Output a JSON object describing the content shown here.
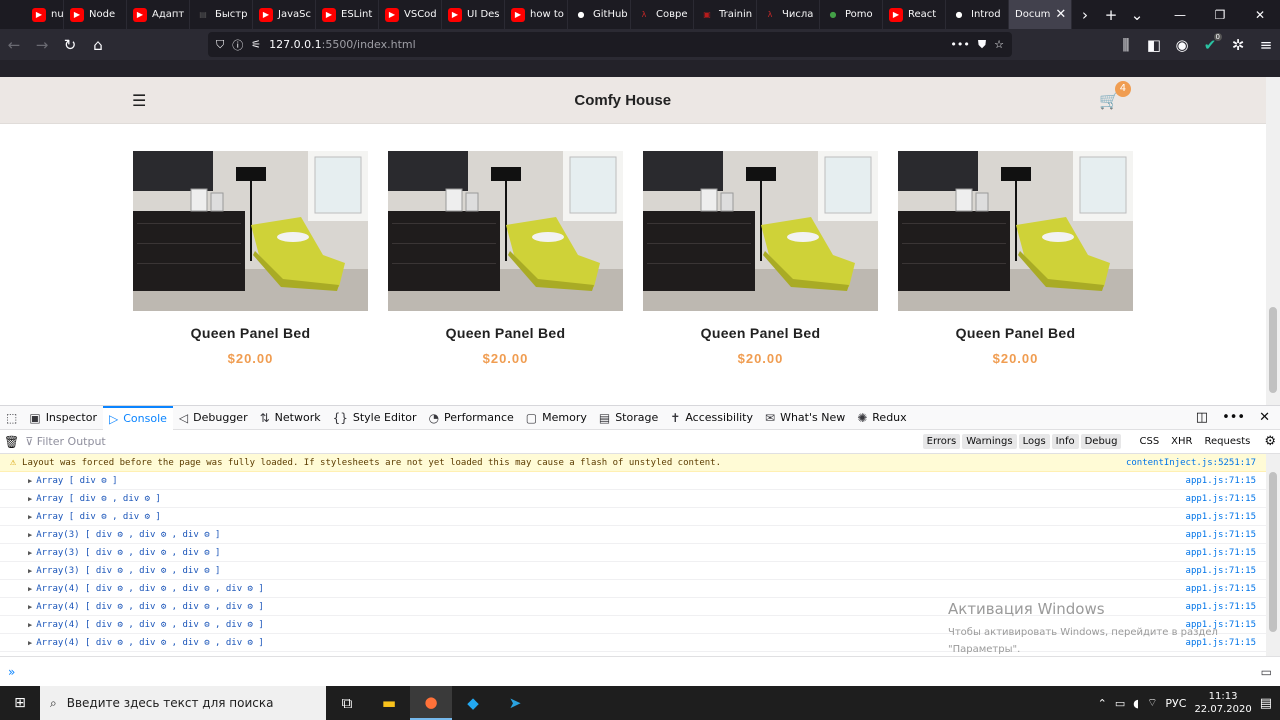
{
  "browser": {
    "tabs": [
      {
        "label": "nu",
        "icon": "youtube-icon",
        "color": "#ff0000"
      },
      {
        "label": "Node",
        "icon": "youtube-icon",
        "color": "#ff0000"
      },
      {
        "label": "Адапт",
        "icon": "youtube-icon",
        "color": "#ff0000"
      },
      {
        "label": "Быстр",
        "icon": "doc-icon",
        "color": "#555555"
      },
      {
        "label": "JavaSc",
        "icon": "youtube-icon",
        "color": "#ff0000"
      },
      {
        "label": "ESLint",
        "icon": "youtube-icon",
        "color": "#ff0000"
      },
      {
        "label": "VSCod",
        "icon": "youtube-icon",
        "color": "#ff0000"
      },
      {
        "label": "UI Des",
        "icon": "youtube-icon",
        "color": "#ff0000"
      },
      {
        "label": "how to",
        "icon": "youtube-icon",
        "color": "#ff0000"
      },
      {
        "label": "GitHub",
        "icon": "github-icon",
        "color": "#ffffff"
      },
      {
        "label": "Совре",
        "icon": "lambda-icon",
        "color": "#c62828"
      },
      {
        "label": "Trainin",
        "icon": "codewars-icon",
        "color": "#b71c1c"
      },
      {
        "label": "Числа",
        "icon": "lambda-icon",
        "color": "#c62828"
      },
      {
        "label": "Pomo",
        "icon": "tomato-icon",
        "color": "#43a047"
      },
      {
        "label": "React",
        "icon": "youtube-icon",
        "color": "#ff0000"
      },
      {
        "label": "Introd",
        "icon": "github-icon",
        "color": "#ffffff"
      },
      {
        "label": "Docum",
        "icon": "none",
        "color": "#42414d",
        "active": true
      }
    ],
    "url_host": "127.0.0.1",
    "url_rest": ":5500/index.html",
    "toolbar_badge": "0"
  },
  "site": {
    "brand": "Comfy House",
    "cart_count": "4",
    "products": [
      {
        "name": "Queen Panel Bed",
        "price": "$20.00"
      },
      {
        "name": "Queen Panel Bed",
        "price": "$20.00"
      },
      {
        "name": "Queen Panel Bed",
        "price": "$20.00"
      },
      {
        "name": "Queen Panel Bed",
        "price": "$20.00"
      }
    ]
  },
  "devtools": {
    "tabs": [
      {
        "label": "Inspector",
        "icon": "inspector-icon",
        "glyph": "▣"
      },
      {
        "label": "Console",
        "icon": "console-icon",
        "glyph": "▷",
        "selected": true
      },
      {
        "label": "Debugger",
        "icon": "debugger-icon",
        "glyph": "◁"
      },
      {
        "label": "Network",
        "icon": "network-icon",
        "glyph": "⇅"
      },
      {
        "label": "Style Editor",
        "icon": "style-editor-icon",
        "glyph": "{}"
      },
      {
        "label": "Performance",
        "icon": "performance-icon",
        "glyph": "◔"
      },
      {
        "label": "Memory",
        "icon": "memory-icon",
        "glyph": "▢"
      },
      {
        "label": "Storage",
        "icon": "storage-icon",
        "glyph": "▤"
      },
      {
        "label": "Accessibility",
        "icon": "accessibility-icon",
        "glyph": "✝"
      },
      {
        "label": "What's New",
        "icon": "whats-new-icon",
        "glyph": "✉"
      },
      {
        "label": "Redux",
        "icon": "redux-icon",
        "glyph": "✺"
      }
    ],
    "filter_placeholder": "Filter Output",
    "filter_buttons": [
      "Errors",
      "Warnings",
      "Logs",
      "Info",
      "Debug"
    ],
    "filter_extra": [
      "CSS",
      "XHR",
      "Requests"
    ],
    "warning": {
      "text": "Layout was forced before the page was fully loaded. If stylesheets are not yet loaded this may cause a flash of unstyled content.",
      "source": "contentInject.js:5251:17"
    },
    "logs": [
      {
        "text": "Array [ div ⚙ ]",
        "source": "app1.js:71:15"
      },
      {
        "text": "Array [ div ⚙ , div ⚙  ]",
        "source": "app1.js:71:15"
      },
      {
        "text": "Array [ div ⚙ , div ⚙  ]",
        "source": "app1.js:71:15"
      },
      {
        "text": "Array(3) [ div ⚙ , div ⚙ , div ⚙  ]",
        "source": "app1.js:71:15"
      },
      {
        "text": "Array(3) [ div ⚙ , div ⚙ , div ⚙  ]",
        "source": "app1.js:71:15"
      },
      {
        "text": "Array(3) [ div ⚙ , div ⚙ , div ⚙  ]",
        "source": "app1.js:71:15"
      },
      {
        "text": "Array(4) [ div ⚙ , div ⚙ , div ⚙ , div ⚙  ]",
        "source": "app1.js:71:15"
      },
      {
        "text": "Array(4) [ div ⚙ , div ⚙ , div ⚙ , div ⚙  ]",
        "source": "app1.js:71:15"
      },
      {
        "text": "Array(4) [ div ⚙ , div ⚙ , div ⚙ , div ⚙  ]",
        "source": "app1.js:71:15"
      },
      {
        "text": "Array(4) [ div ⚙ , div ⚙ , div ⚙ , div ⚙  ]",
        "source": "app1.js:71:15"
      }
    ],
    "input_prompt": "»"
  },
  "activation": {
    "title": "Активация Windows",
    "line1": "Чтобы активировать Windows, перейдите в раздел",
    "line2": "\"Параметры\"."
  },
  "taskbar": {
    "search_placeholder": "Введите здесь текст для поиска",
    "lang": "РУС",
    "time": "11:13",
    "date": "22.07.2020"
  }
}
